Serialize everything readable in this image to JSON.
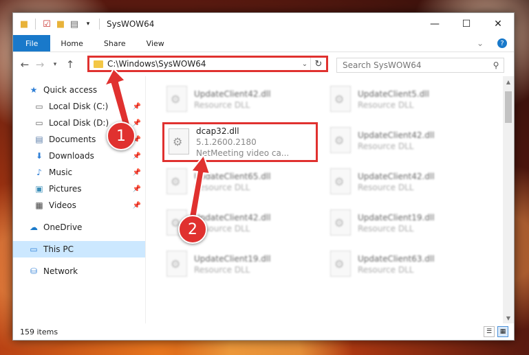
{
  "window": {
    "title": "SysWOW64"
  },
  "ribbon": {
    "file": "File",
    "home": "Home",
    "share": "Share",
    "view": "View"
  },
  "address": {
    "path": "C:\\Windows\\SysWOW64"
  },
  "search": {
    "placeholder": "Search SysWOW64"
  },
  "nav": {
    "quick_access": "Quick access",
    "items": [
      {
        "label": "Local Disk (C:)",
        "icon": "drive-icon"
      },
      {
        "label": "Local Disk (D:)",
        "icon": "drive-icon"
      },
      {
        "label": "Documents",
        "icon": "documents-icon"
      },
      {
        "label": "Downloads",
        "icon": "downloads-icon"
      },
      {
        "label": "Music",
        "icon": "music-icon"
      },
      {
        "label": "Pictures",
        "icon": "pictures-icon"
      },
      {
        "label": "Videos",
        "icon": "videos-icon"
      }
    ],
    "onedrive": "OneDrive",
    "this_pc": "This PC",
    "network": "Network"
  },
  "files": [
    {
      "name": "UpdateClient42.dll",
      "line2": "Resource DLL"
    },
    {
      "name": "UpdateClient5.dll",
      "line2": "Resource DLL"
    },
    {
      "name": "dcap32.dll",
      "line2": "5.1.2600.2180",
      "line3": "NetMeeting video ca..."
    },
    {
      "name": "UpdateClient42.dll",
      "line2": "Resource DLL"
    },
    {
      "name": "UpdateClient65.dll",
      "line2": "Resource DLL"
    },
    {
      "name": "UpdateClient42.dll",
      "line2": "Resource DLL"
    },
    {
      "name": "UpdateClient42.dll",
      "line2": "Resource DLL"
    },
    {
      "name": "UpdateClient19.dll",
      "line2": "Resource DLL"
    },
    {
      "name": "UpdateClient19.dll",
      "line2": "Resource DLL"
    },
    {
      "name": "UpdateClient63.dll",
      "line2": "Resource DLL"
    }
  ],
  "status": {
    "count": "159 items"
  },
  "steps": {
    "one": "1",
    "two": "2"
  },
  "colors": {
    "accent": "#1979ca",
    "highlight": "#e0312f",
    "selected": "#cce8ff"
  }
}
